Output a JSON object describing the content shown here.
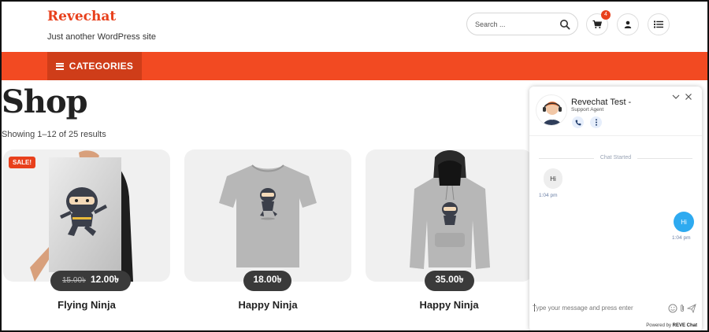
{
  "site": {
    "title": "Revechat",
    "tagline": "Just another WordPress site"
  },
  "header": {
    "search_placeholder": "Search ...",
    "cart_count": "4",
    "icons": [
      "search-icon",
      "cart-icon",
      "user-icon",
      "list-icon"
    ]
  },
  "nav": {
    "categories_label": "CATEGORIES"
  },
  "shop": {
    "title": "Shop",
    "result_count": "Showing 1–12 of 25 results",
    "products": [
      {
        "name": "Flying Ninja",
        "price": "12.00৳",
        "old_price": "15.00৳",
        "badge": "SALE!"
      },
      {
        "name": "Happy Ninja",
        "price": "18.00৳"
      },
      {
        "name": "Happy Ninja",
        "price": "35.00৳"
      }
    ]
  },
  "chat": {
    "agent_name": "Revechat Test -",
    "agent_role": "Support Agent",
    "started_label": "Chat Started",
    "messages": [
      {
        "from": "visitor",
        "text": "Hi",
        "time": "1:04 pm"
      },
      {
        "from": "agent",
        "text": "Hi",
        "time": "1:04 pm"
      }
    ],
    "input_placeholder": "Type your message and press enter",
    "powered_by": "Powered by",
    "powered_brand": "REVE Chat"
  },
  "colors": {
    "brand": "#e8401c",
    "navbar": "#f24a22",
    "category_button": "#cf3d19",
    "chat_bubble_out": "#2eaaf0"
  }
}
